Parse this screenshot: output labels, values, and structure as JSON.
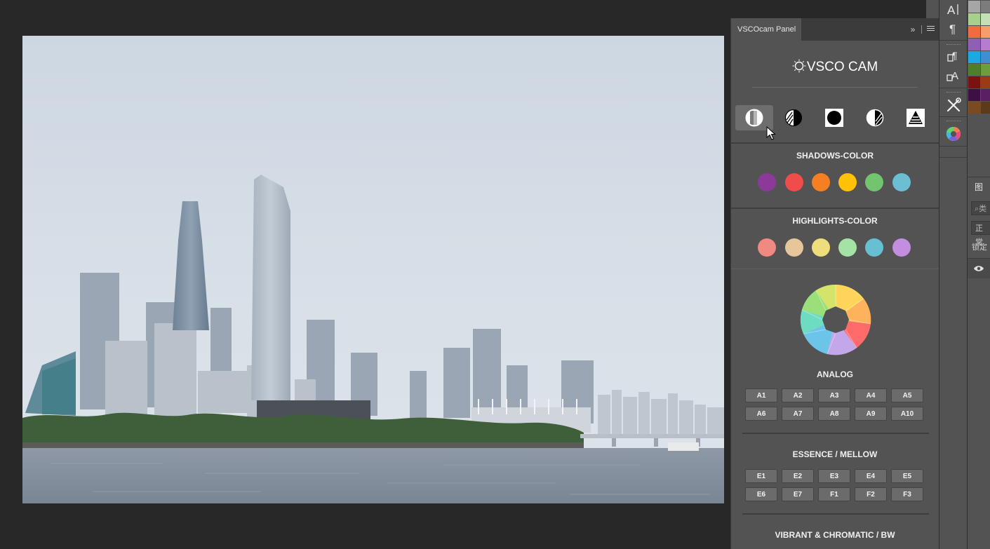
{
  "panel": {
    "tab_title": "VSCOcam Panel",
    "collapse_glyph": "»",
    "logo_text": "VSCO CAM",
    "tools": [
      {
        "name": "split-toning-tool-icon",
        "active": true
      },
      {
        "name": "contrast-hatched-tool-icon",
        "active": false
      },
      {
        "name": "solid-circle-tool-icon",
        "active": false
      },
      {
        "name": "half-hatched-tool-icon",
        "active": false
      },
      {
        "name": "pyramid-tool-icon",
        "active": false
      }
    ],
    "shadows": {
      "title": "SHADOWS-COLOR",
      "colors": [
        "#8b3a9a",
        "#f04c4c",
        "#f57f22",
        "#ffc107",
        "#72c46e",
        "#6cbfd3"
      ]
    },
    "highlights": {
      "title": "HIGHLIGHTS-COLOR",
      "colors": [
        "#f08a80",
        "#e8c69c",
        "#efdc7c",
        "#a4e2a6",
        "#67bfd2",
        "#c38ee0"
      ]
    },
    "analog": {
      "title": "ANALOG",
      "buttons": [
        "A1",
        "A2",
        "A3",
        "A4",
        "A5",
        "A6",
        "A7",
        "A8",
        "A9",
        "A10"
      ]
    },
    "essence": {
      "title": "ESSENCE / MELLOW",
      "buttons": [
        "E1",
        "E2",
        "E3",
        "E4",
        "E5",
        "E6",
        "E7",
        "F1",
        "F2",
        "F3"
      ]
    },
    "vibrant": {
      "title": "VIBRANT & CHROMATIC / BW"
    }
  },
  "toolstrip": {
    "icons": [
      "character-panel-icon",
      "paragraph-icon",
      "paragraph-styles-icon",
      "character-styles-icon",
      "tools-icon",
      "color-wheel-icon"
    ]
  },
  "right_dock": {
    "swatches": [
      "#a6a6a6",
      "#7c7c7c",
      "#a8d08d",
      "#c5e0b4",
      "#f26a40",
      "#f79c6a",
      "#8e5fb4",
      "#b57cd2",
      "#1ea8e0",
      "#3f8fd0",
      "#4d7f2a",
      "#6d9e3e",
      "#7a1212",
      "#9c3a18",
      "#3d0f45",
      "#5a1f63",
      "#7a4a20",
      "#5c3a1a"
    ],
    "layers_tab": "图层",
    "search_placeholder": "类",
    "blend_mode": "正常",
    "lock_label": "锁定"
  }
}
